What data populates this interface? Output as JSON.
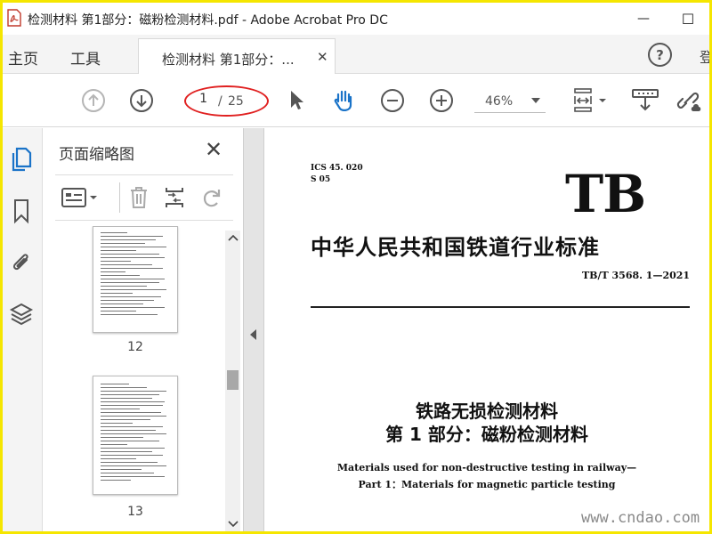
{
  "window": {
    "title": "检测材料 第1部分：磁粉检测材料.pdf - Adobe Acrobat Pro DC",
    "minimize_symbol": "—",
    "maximize_symbol": "☐"
  },
  "tabs": {
    "home": "主页",
    "tools": "工具",
    "document_tab": "检测材料 第1部分：...",
    "document_tab_close": "✕",
    "help": "?",
    "right_cut_text": "登"
  },
  "toolbar": {
    "page_current": "1",
    "page_separator": "/",
    "page_total": "25",
    "zoom": "46%",
    "icons": [
      "prev-page-icon",
      "next-page-icon",
      "select-cursor-icon",
      "hand-icon",
      "zoom-out-icon",
      "zoom-in-icon",
      "fit-page-icon",
      "print-icon",
      "share-link-icon"
    ],
    "accent_color": "#1a73c8",
    "annotation_color": "#e02020"
  },
  "left_rail": {
    "icons": [
      "pages-icon",
      "bookmark-icon",
      "attachment-icon",
      "layers-icon"
    ]
  },
  "thumbnails": {
    "title": "页面缩略图",
    "close": "✕",
    "pages": [
      {
        "number": "12"
      },
      {
        "number": "13"
      }
    ]
  },
  "document": {
    "ics": "ICS 45. 020",
    "classification": "S 05",
    "logo": "TB",
    "standard_name": "中华人民共和国铁道行业标准",
    "standard_number": "TB/T 3568. 1—2021",
    "title_line1": "铁路无损检测材料",
    "title_line2": "第 1 部分：磁粉检测材料",
    "english_line1": "Materials used for non-destructive testing in railway—",
    "english_line2": "Part 1：Materials for magnetic particle testing"
  },
  "watermark": "www.cndao.com"
}
